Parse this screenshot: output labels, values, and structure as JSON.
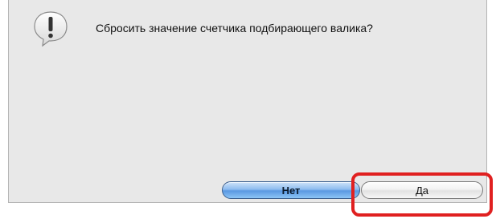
{
  "dialog": {
    "message": "Сбросить значение счетчика подбирающего валика?",
    "icon": "alert-icon"
  },
  "buttons": {
    "no_label": "Нет",
    "yes_label": "Да"
  },
  "colors": {
    "dialog_bg": "#e8e8e8",
    "default_button": "#5a98e2",
    "highlight": "#e02020"
  }
}
